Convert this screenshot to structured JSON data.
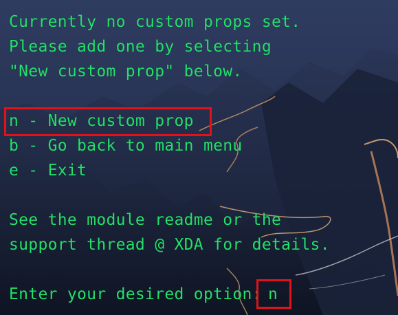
{
  "terminal": {
    "lines": {
      "l1": "Currently no custom props set.",
      "l2": "Please add one by selecting",
      "l3": "\"New custom prop\" below.",
      "l4": "n - New custom prop",
      "l5": "b - Go back to main menu",
      "l6": "e - Exit",
      "l7": "See the module readme or the",
      "l8": "support thread @ XDA for details.",
      "l9": "Enter your desired option: "
    },
    "input_value": "n",
    "text_color": "#23e06a",
    "highlight_color": "#e0131b"
  }
}
